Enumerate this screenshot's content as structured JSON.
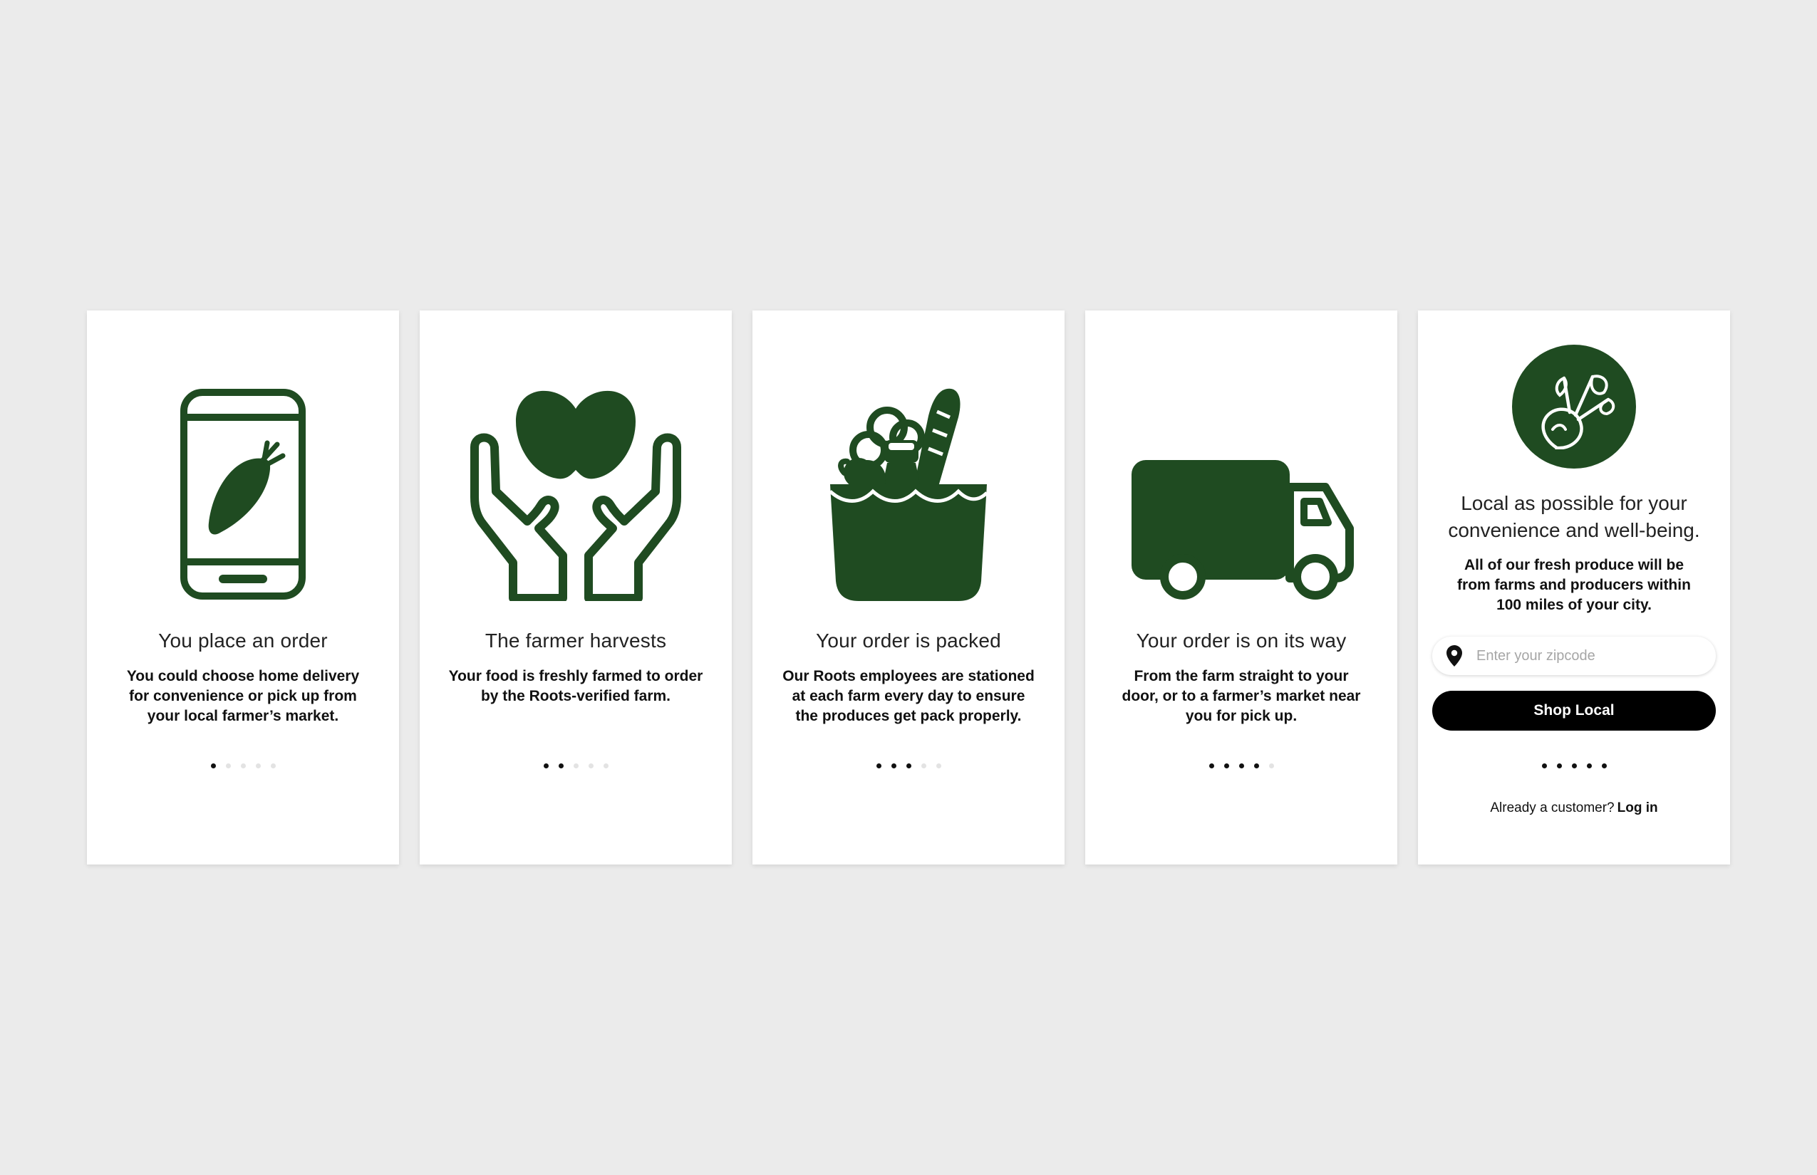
{
  "colors": {
    "background": "#ebebeb",
    "card": "#ffffff",
    "brand_green": "#1f4b21",
    "button": "#000000",
    "dot_active": "#111111",
    "dot_inactive": "#e3e3e3"
  },
  "slides": [
    {
      "icon": "phone-with-carrot-icon",
      "title": "You place an order",
      "description": "You could choose home delivery for convenience or pick up from your local farmer’s market.",
      "active_dots": 1
    },
    {
      "icon": "hands-holding-fruit-icon",
      "title": "The farmer harvests",
      "description": "Your food is freshly farmed to order by the Roots-verified farm.",
      "active_dots": 2
    },
    {
      "icon": "grocery-bag-icon",
      "title": "Your order is packed",
      "description": "Our Roots employees are stationed at each farm every day to ensure the produces get pack properly.",
      "active_dots": 3
    },
    {
      "icon": "delivery-truck-icon",
      "title": "Your order is on its way",
      "description": "From the farm straight to your door, or to a farmer’s market near you for pick up.",
      "active_dots": 4
    }
  ],
  "final_slide": {
    "icon": "beet-icon",
    "headline": "Local as possible for your convenience and well-being.",
    "subtext": "All of our fresh produce will be from farms and producers within 100 miles of your city.",
    "zip_placeholder": "Enter your zipcode",
    "zip_icon": "location-pin-icon",
    "shop_button": "Shop Local",
    "login_prompt": "Already a customer?",
    "login_link": "Log in",
    "active_dots": 5
  },
  "dot_count": 5
}
